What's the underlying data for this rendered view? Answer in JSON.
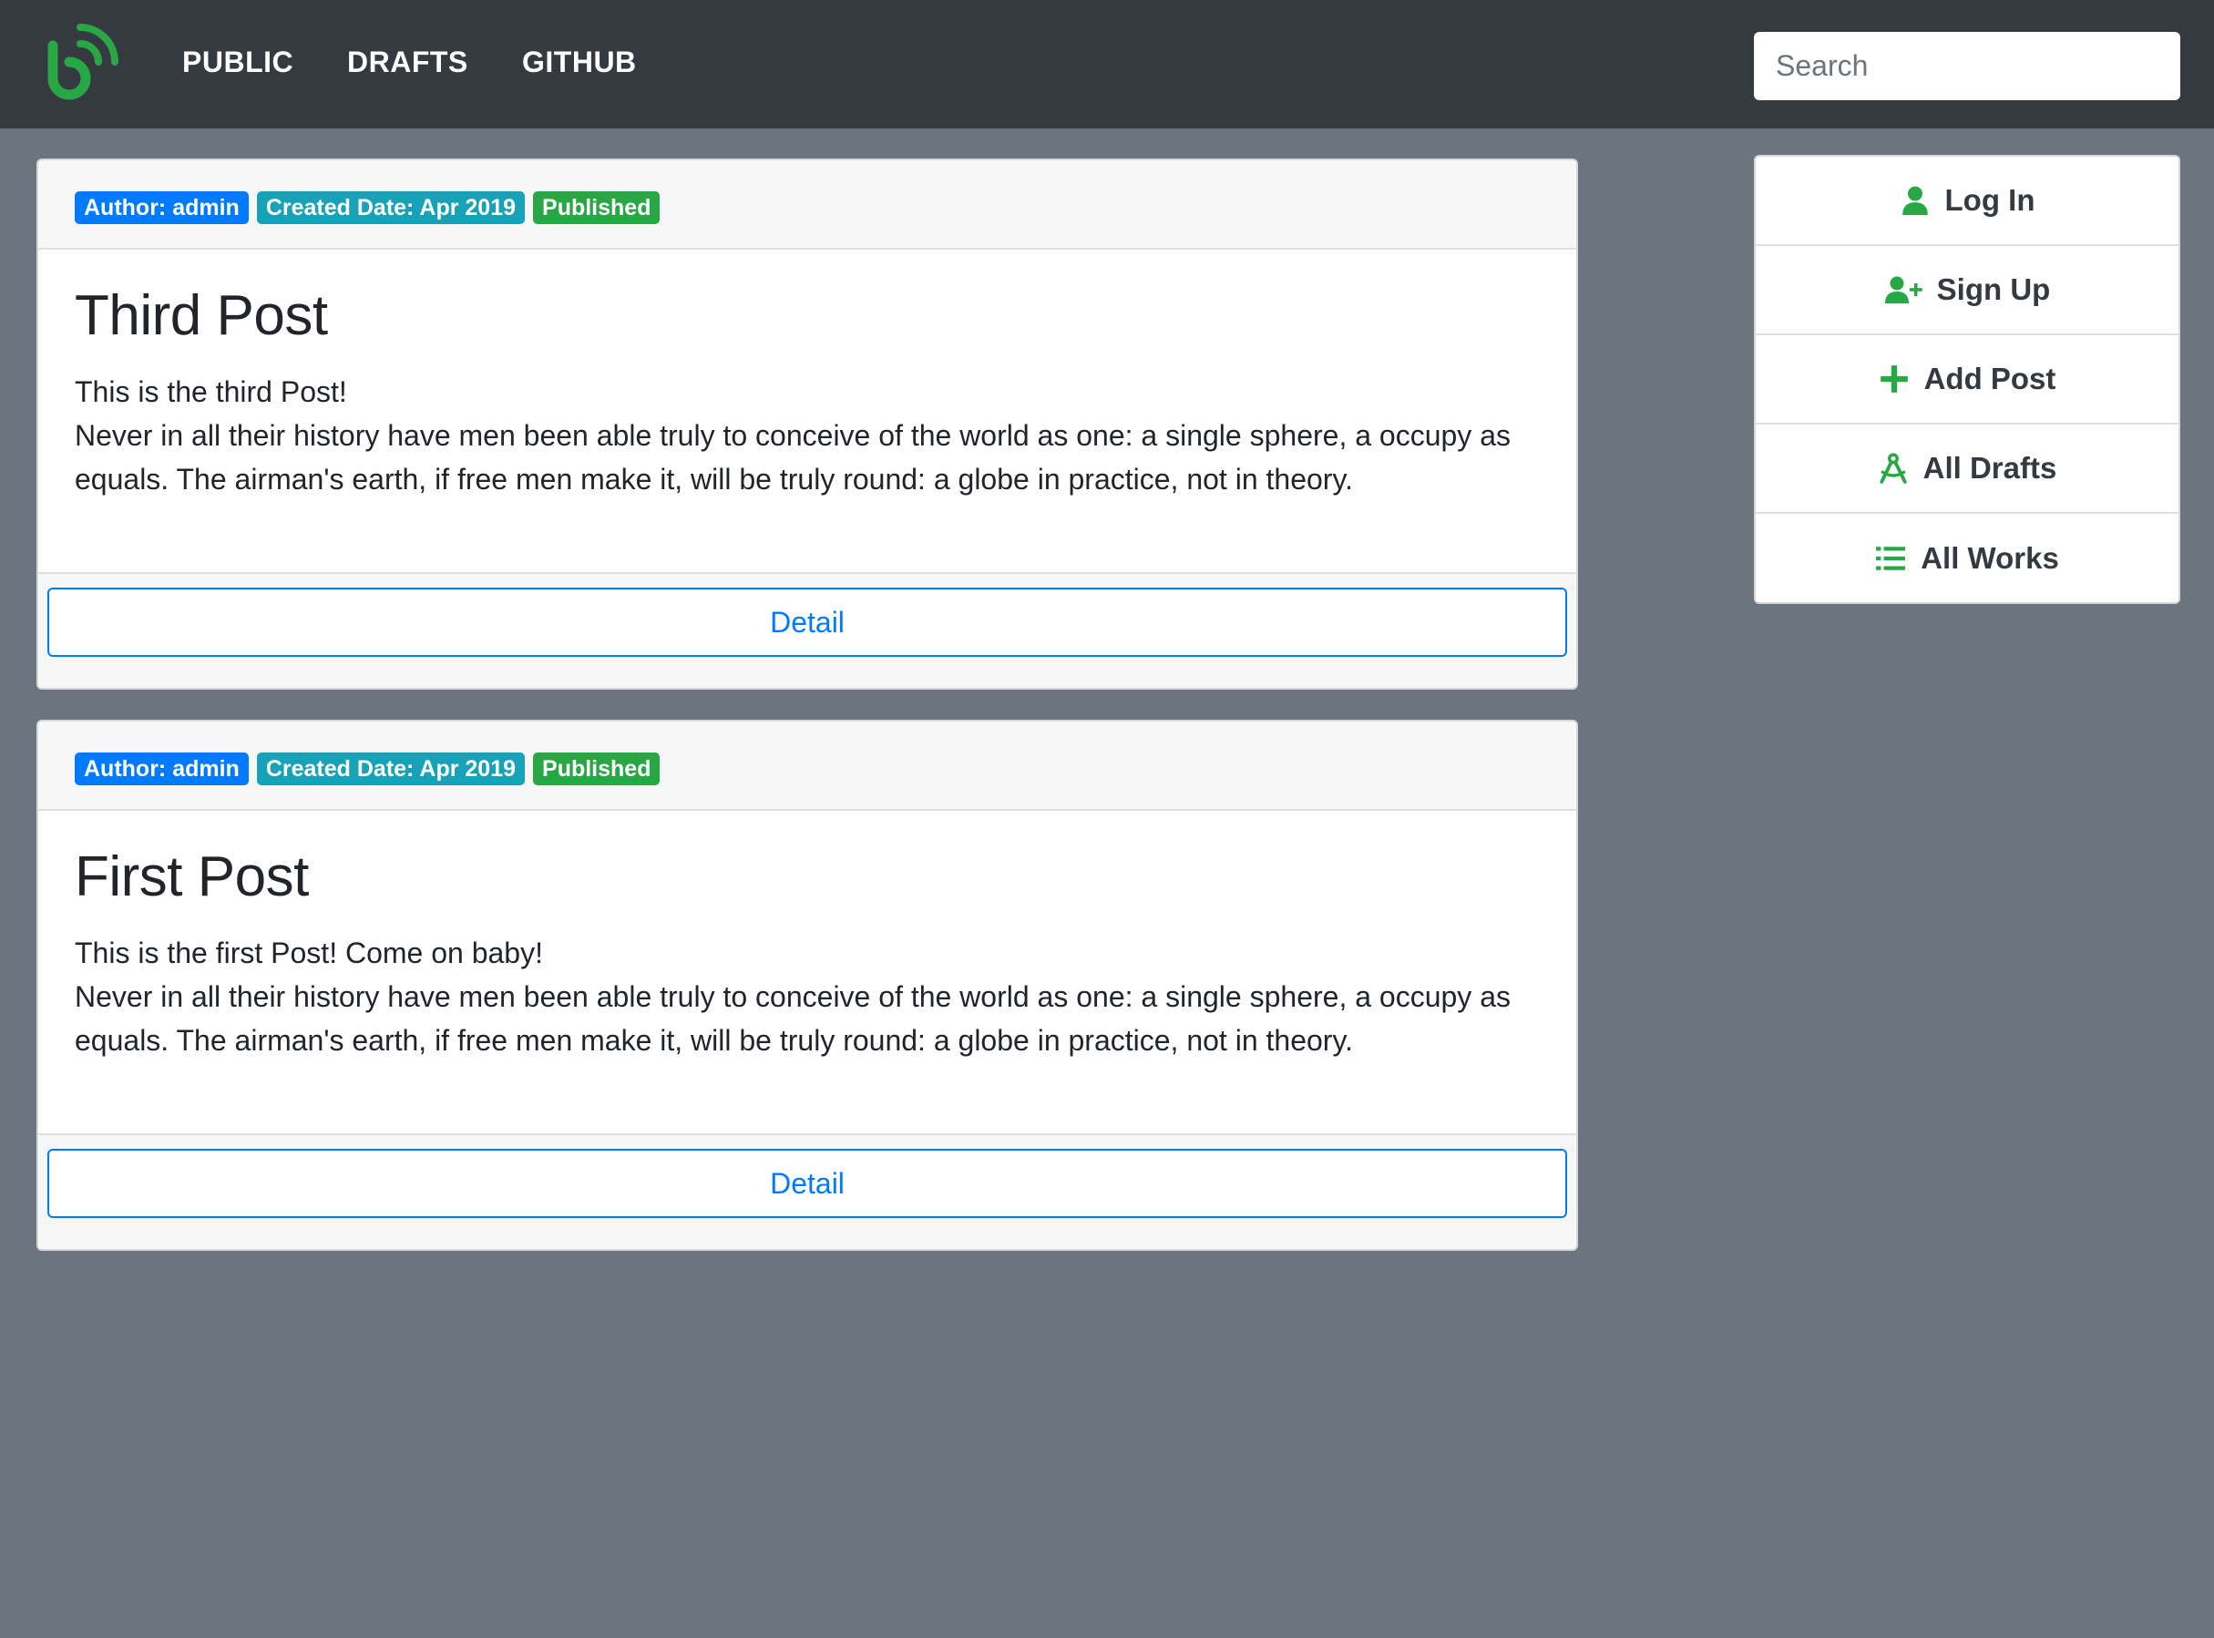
{
  "navbar": {
    "links": [
      {
        "label": "PUBLIC"
      },
      {
        "label": "DRAFTS"
      },
      {
        "label": "GITHUB"
      }
    ],
    "search": {
      "placeholder": "Search",
      "icon": "search-icon"
    },
    "logo_icon": "blog-logo-icon"
  },
  "posts": [
    {
      "author_badge": "Author: admin",
      "date_badge": "Created Date: Apr 2019",
      "status_badge": "Published",
      "title": "Third Post",
      "text_line1": "This is the third Post!",
      "text_line2": "Never in all their history have men been able truly to conceive of the world as one: a single sphere, a occupy as equals. The airman's earth, if free men make it, will be truly round: a globe in practice, not in theory.",
      "detail_label": "Detail"
    },
    {
      "author_badge": "Author: admin",
      "date_badge": "Created Date: Apr 2019",
      "status_badge": "Published",
      "title": "First Post",
      "text_line1": "This is the first Post! Come on baby!",
      "text_line2": "Never in all their history have men been able truly to conceive of the world as one: a single sphere, a occupy as equals. The airman's earth, if free men make it, will be truly round: a globe in practice, not in theory.",
      "detail_label": "Detail"
    }
  ],
  "side_menu": {
    "items": [
      {
        "label": "Log In",
        "icon": "user-icon"
      },
      {
        "label": "Sign Up",
        "icon": "user-plus-icon"
      },
      {
        "label": "Add Post",
        "icon": "plus-icon"
      },
      {
        "label": "All Drafts",
        "icon": "drafting-compass-icon"
      },
      {
        "label": "All Works",
        "icon": "list-icon"
      }
    ]
  },
  "colors": {
    "navbar_bg": "#343a40",
    "page_bg": "#6c757d",
    "accent_green": "#28a745",
    "primary_blue": "#007bff",
    "info_teal": "#17a2b8"
  }
}
